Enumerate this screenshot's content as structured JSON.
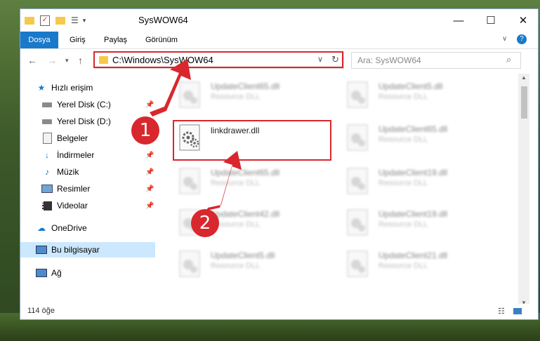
{
  "window": {
    "title": "SysWOW64"
  },
  "ribbon": {
    "tabs": [
      "Dosya",
      "Giriş",
      "Paylaş",
      "Görünüm"
    ]
  },
  "address": {
    "path": "C:\\Windows\\SysWOW64"
  },
  "search": {
    "placeholder": "Ara: SysWOW64"
  },
  "sidebar": {
    "items": [
      {
        "label": "Hızlı erişim",
        "icon": "star-icon"
      },
      {
        "label": "Yerel Disk (C:)",
        "icon": "drive-icon"
      },
      {
        "label": "Yerel Disk (D:)",
        "icon": "drive-icon"
      },
      {
        "label": "Belgeler",
        "icon": "document-icon"
      },
      {
        "label": "İndirmeler",
        "icon": "download-icon"
      },
      {
        "label": "Müzik",
        "icon": "music-icon"
      },
      {
        "label": "Resimler",
        "icon": "picture-icon"
      },
      {
        "label": "Videolar",
        "icon": "video-icon"
      },
      {
        "label": "OneDrive",
        "icon": "cloud-icon"
      },
      {
        "label": "Bu bilgisayar",
        "icon": "computer-icon"
      },
      {
        "label": "Ağ",
        "icon": "network-icon"
      }
    ]
  },
  "files": [
    {
      "name": "UpdateClient65.dll",
      "type": "Resource DLL"
    },
    {
      "name": "UpdateClient5.dll",
      "type": "Resource DLL"
    },
    {
      "name": "linkdrawer.dll",
      "type": ""
    },
    {
      "name": "UpdateClient65.dll",
      "type": "Resource DLL"
    },
    {
      "name": "UpdateClient65.dll",
      "type": "Resource DLL"
    },
    {
      "name": "UpdateClient19.dll",
      "type": "Resource DLL"
    },
    {
      "name": "UpdateClient42.dll",
      "type": "Resource DLL"
    },
    {
      "name": "UpdateClient19.dll",
      "type": "Resource DLL"
    },
    {
      "name": "UpdateClient5.dll",
      "type": "Resource DLL"
    },
    {
      "name": "UpdateClient21.dll",
      "type": "Resource DLL"
    }
  ],
  "status": {
    "count": "114 öğe"
  },
  "annotations": {
    "step1": "1",
    "step2": "2"
  },
  "colors": {
    "accent": "#1979ca",
    "annotation": "#d9272e"
  }
}
